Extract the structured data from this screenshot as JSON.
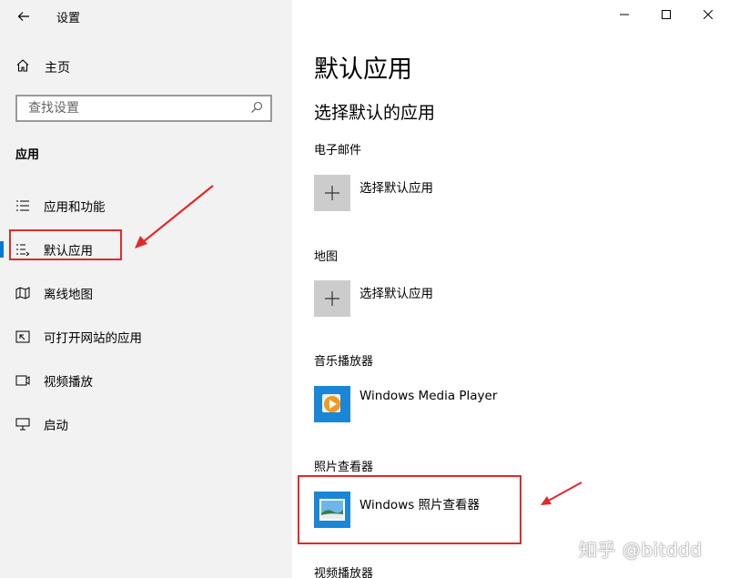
{
  "window": {
    "title": "设置"
  },
  "sidebar": {
    "home_label": "主页",
    "search_placeholder": "查找设置",
    "section_label": "应用",
    "items": [
      {
        "label": "应用和功能",
        "icon": "apps-features-icon"
      },
      {
        "label": "默认应用",
        "icon": "default-apps-icon",
        "selected": true
      },
      {
        "label": "离线地图",
        "icon": "offline-maps-icon"
      },
      {
        "label": "可打开网站的应用",
        "icon": "apps-for-websites-icon"
      },
      {
        "label": "视频播放",
        "icon": "video-playback-icon"
      },
      {
        "label": "启动",
        "icon": "startup-icon"
      }
    ]
  },
  "main": {
    "title": "默认应用",
    "subtitle": "选择默认的应用",
    "categories": [
      {
        "label": "电子邮件",
        "app": "选择默认应用",
        "icon": "plus-icon"
      },
      {
        "label": "地图",
        "app": "选择默认应用",
        "icon": "plus-icon"
      },
      {
        "label": "音乐播放器",
        "app": "Windows Media Player",
        "icon": "windows-media-player-icon"
      },
      {
        "label": "照片查看器",
        "app": "Windows 照片查看器",
        "icon": "windows-photo-viewer-icon"
      },
      {
        "label": "视频播放器"
      }
    ]
  },
  "watermark": "知乎 @bitddd",
  "colors": {
    "accent": "#0078d7",
    "highlight": "#e02a2a",
    "sidebar_bg": "#f2f2f2"
  }
}
